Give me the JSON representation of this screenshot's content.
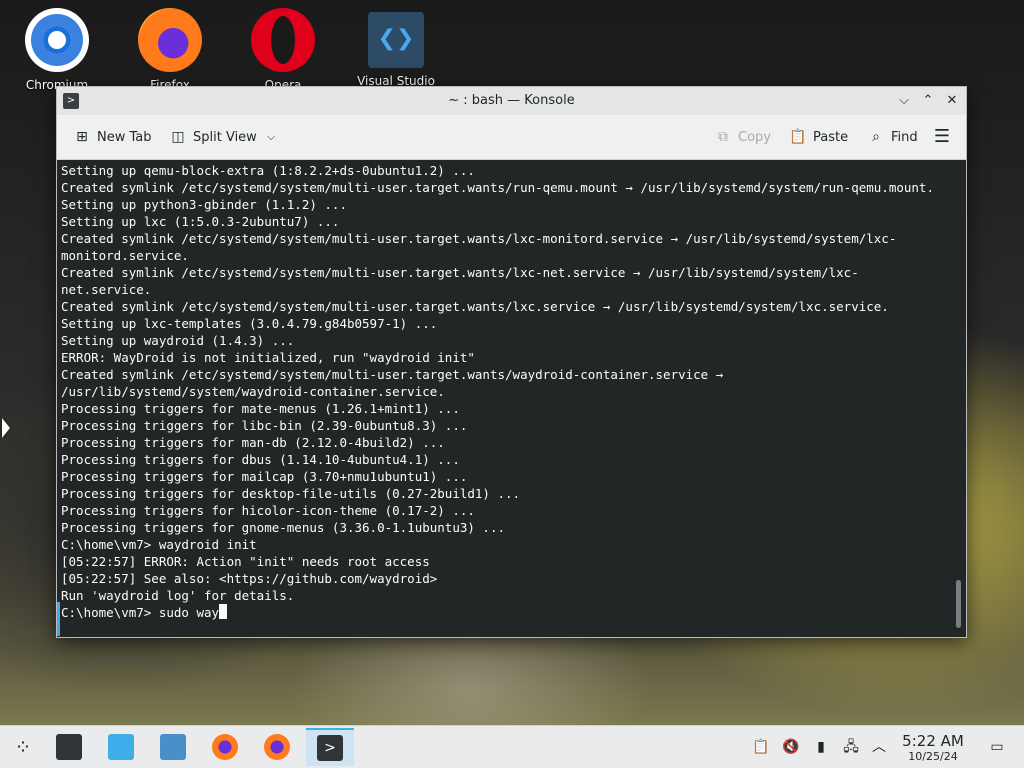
{
  "desktop": {
    "icons": [
      {
        "label": "Chromium"
      },
      {
        "label": "Firefox"
      },
      {
        "label": "Opera"
      },
      {
        "label": "Visual Studio"
      }
    ]
  },
  "window": {
    "title": "~ : bash — Konsole",
    "controls": {
      "minimize": "⌵",
      "maximize": "⌃",
      "close": "✕"
    }
  },
  "toolbar": {
    "new_tab": "New Tab",
    "split_view": "Split View",
    "copy": "Copy",
    "paste": "Paste",
    "find": "Find"
  },
  "terminal": {
    "lines": [
      "Setting up qemu-block-extra (1:8.2.2+ds-0ubuntu1.2) ...",
      "Created symlink /etc/systemd/system/multi-user.target.wants/run-qemu.mount → /usr/lib/systemd/system/run-qemu.mount.",
      "Setting up python3-gbinder (1.1.2) ...",
      "Setting up lxc (1:5.0.3-2ubuntu7) ...",
      "Created symlink /etc/systemd/system/multi-user.target.wants/lxc-monitord.service → /usr/lib/systemd/system/lxc-monitord.service.",
      "Created symlink /etc/systemd/system/multi-user.target.wants/lxc-net.service → /usr/lib/systemd/system/lxc-net.service.",
      "Created symlink /etc/systemd/system/multi-user.target.wants/lxc.service → /usr/lib/systemd/system/lxc.service.",
      "Setting up lxc-templates (3.0.4.79.g84b0597-1) ...",
      "Setting up waydroid (1.4.3) ...",
      "ERROR: WayDroid is not initialized, run \"waydroid init\"",
      "Created symlink /etc/systemd/system/multi-user.target.wants/waydroid-container.service → /usr/lib/systemd/system/waydroid-container.service.",
      "Processing triggers for mate-menus (1.26.1+mint1) ...",
      "Processing triggers for libc-bin (2.39-0ubuntu8.3) ...",
      "Processing triggers for man-db (2.12.0-4build2) ...",
      "Processing triggers for dbus (1.14.10-4ubuntu4.1) ...",
      "Processing triggers for mailcap (3.70+nmu1ubuntu1) ...",
      "Processing triggers for desktop-file-utils (0.27-2build1) ...",
      "Processing triggers for hicolor-icon-theme (0.17-2) ...",
      "Processing triggers for gnome-menus (3.36.0-1.1ubuntu3) ...",
      "C:\\home\\vm7> waydroid init",
      "[05:22:57] ERROR: Action \"init\" needs root access",
      "[05:22:57] See also: <https://github.com/waydroid>",
      "Run 'waydroid log' for details."
    ],
    "prompt_line": "C:\\home\\vm7> sudo way"
  },
  "taskbar": {
    "clock_time": "5:22 AM",
    "clock_date": "10/25/24"
  },
  "colors": {
    "terminal_bg": "#232627",
    "terminal_fg": "#fcfcfc",
    "accent": "#3daee9"
  }
}
